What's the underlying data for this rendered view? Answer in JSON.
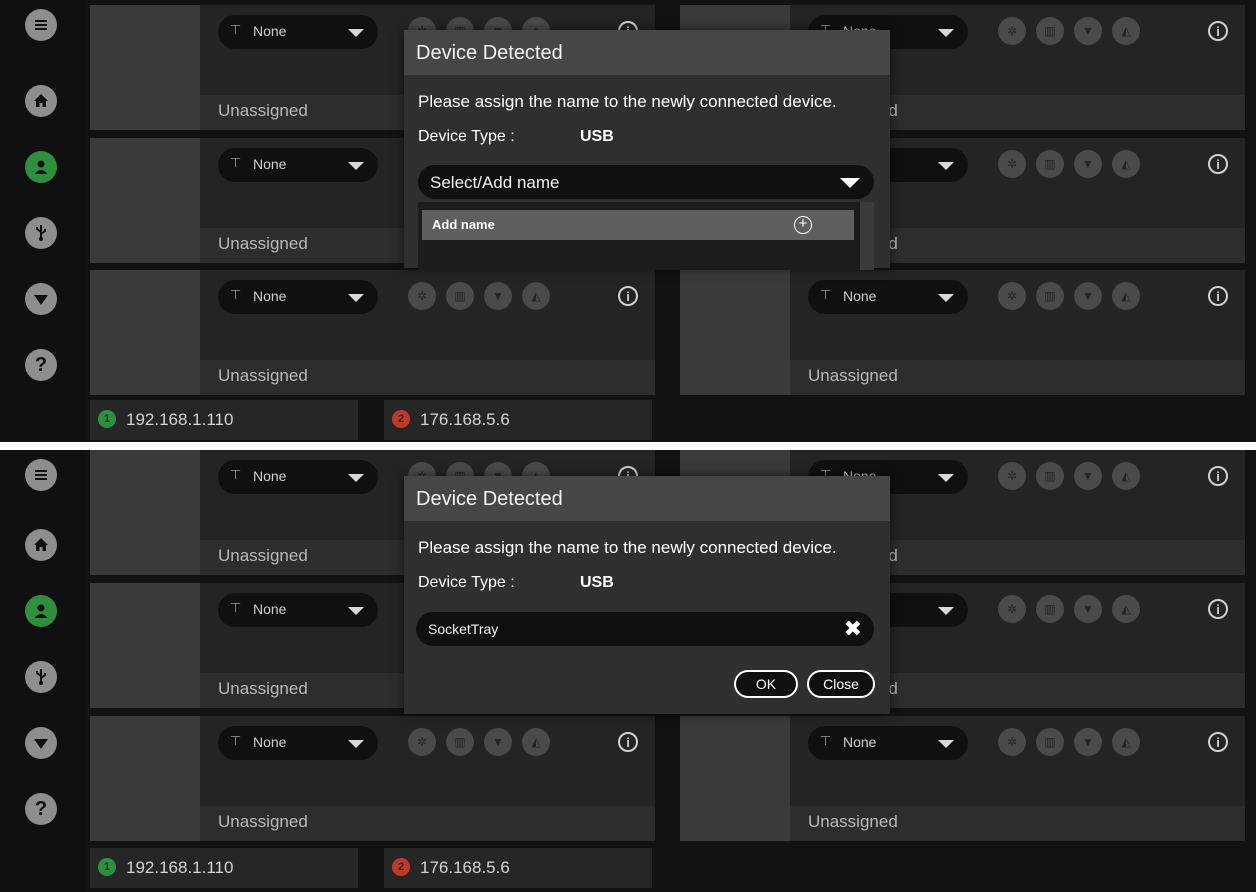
{
  "colors": {
    "app_bg": "#121212",
    "panel_bg": "#242424",
    "thumb_bg": "#3a3a3a",
    "active_green": "#2f8f3e",
    "modal_bg": "#2f2f2f",
    "modal_header": "#464646",
    "ip_ok": "#2f8f3e",
    "ip_error": "#c0392b"
  },
  "sidebar": {
    "items": [
      {
        "name": "menu-icon"
      },
      {
        "name": "home-icon"
      },
      {
        "name": "user-icon",
        "active": true
      },
      {
        "name": "usb-icon"
      },
      {
        "name": "shield-icon"
      },
      {
        "name": "help-icon",
        "glyph": "?"
      }
    ]
  },
  "panels": {
    "filter_value": "None",
    "status_label": "Unassigned",
    "info_glyph": "i"
  },
  "ip_bar": {
    "ip1": {
      "number": "1",
      "address": "192.168.1.110"
    },
    "ip2": {
      "number": "2",
      "address": "176.168.5.6"
    }
  },
  "modal_common": {
    "title": "Device Detected",
    "message": "Please assign the name to the newly connected device.",
    "device_type_label": "Device Type :",
    "device_type_value": "USB"
  },
  "modal_1": {
    "select_placeholder": "Select/Add name",
    "dropdown_items": [
      {
        "label": "Add name",
        "action_icon": "plus-circle-icon"
      }
    ]
  },
  "modal_2": {
    "name_value": "SocketTray",
    "clear_glyph": "✖",
    "ok_label": "OK",
    "close_label": "Close"
  }
}
